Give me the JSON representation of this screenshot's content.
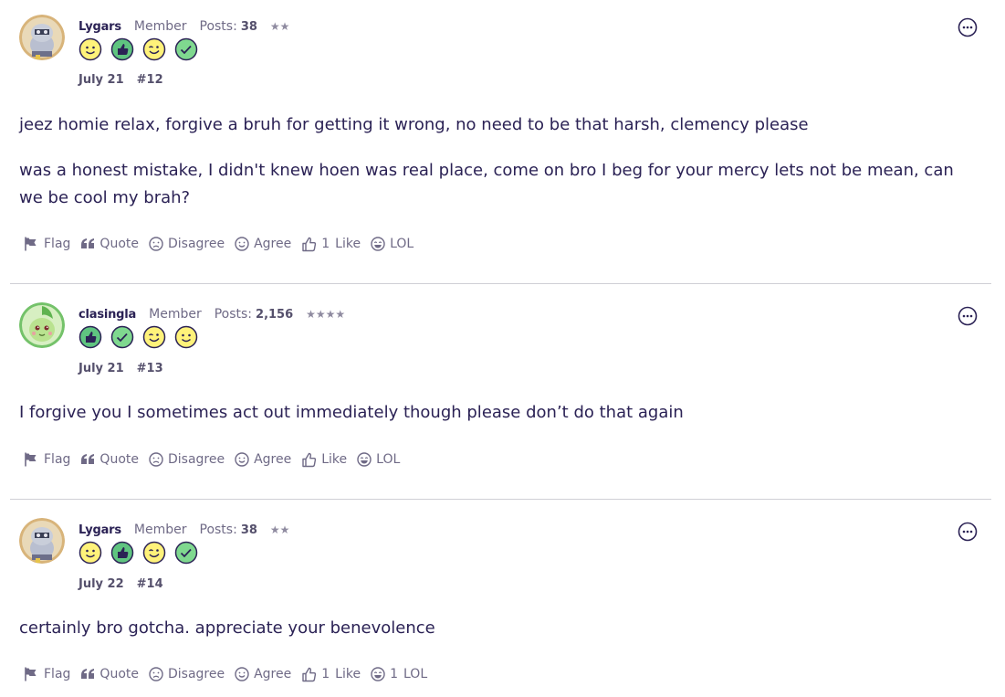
{
  "posts": [
    {
      "username": "Lygars",
      "role": "Member",
      "posts_label": "Posts:",
      "posts_count": "38",
      "stars": "★★",
      "avatar": "lygars-avatar",
      "badges": [
        "smiley",
        "thumbs-up",
        "wink",
        "check"
      ],
      "date": "July 21",
      "number": "#12",
      "paragraphs": [
        "jeez homie relax, forgive a bruh for getting it wrong, no need to be that harsh, clemency please",
        "was a honest mistake, I didn't knew hoen was real place, come on bro I beg for your mercy lets not be mean, can we be cool my brah?"
      ],
      "actions": {
        "flag": "Flag",
        "quote": "Quote",
        "disagree": "Disagree",
        "agree": "Agree",
        "like_count": "1",
        "like": "Like",
        "lol_count": "",
        "lol": "LOL"
      }
    },
    {
      "username": "clasingla",
      "role": "Member",
      "posts_label": "Posts:",
      "posts_count": "2,156",
      "stars": "★★★★",
      "avatar": "chikorita-avatar",
      "badges": [
        "thumbs-up",
        "check",
        "wink",
        "smiley"
      ],
      "date": "July 21",
      "number": "#13",
      "paragraphs": [
        "I forgive you I sometimes act out immediately though please don’t do that again"
      ],
      "actions": {
        "flag": "Flag",
        "quote": "Quote",
        "disagree": "Disagree",
        "agree": "Agree",
        "like_count": "",
        "like": "Like",
        "lol_count": "",
        "lol": "LOL"
      }
    },
    {
      "username": "Lygars",
      "role": "Member",
      "posts_label": "Posts:",
      "posts_count": "38",
      "stars": "★★",
      "avatar": "lygars-avatar",
      "badges": [
        "smiley",
        "thumbs-up",
        "wink",
        "check"
      ],
      "date": "July 22",
      "number": "#14",
      "paragraphs": [
        "certainly bro gotcha. appreciate your benevolence"
      ],
      "actions": {
        "flag": "Flag",
        "quote": "Quote",
        "disagree": "Disagree",
        "agree": "Agree",
        "like_count": "1",
        "like": "Like",
        "lol_count": "1",
        "lol": "LOL"
      }
    }
  ],
  "colors": {
    "text": "#2b2255",
    "muted": "#6f6a86",
    "badge_yellow": "#fff27a",
    "badge_green": "#5fc480",
    "divider": "#cfcfd6"
  }
}
